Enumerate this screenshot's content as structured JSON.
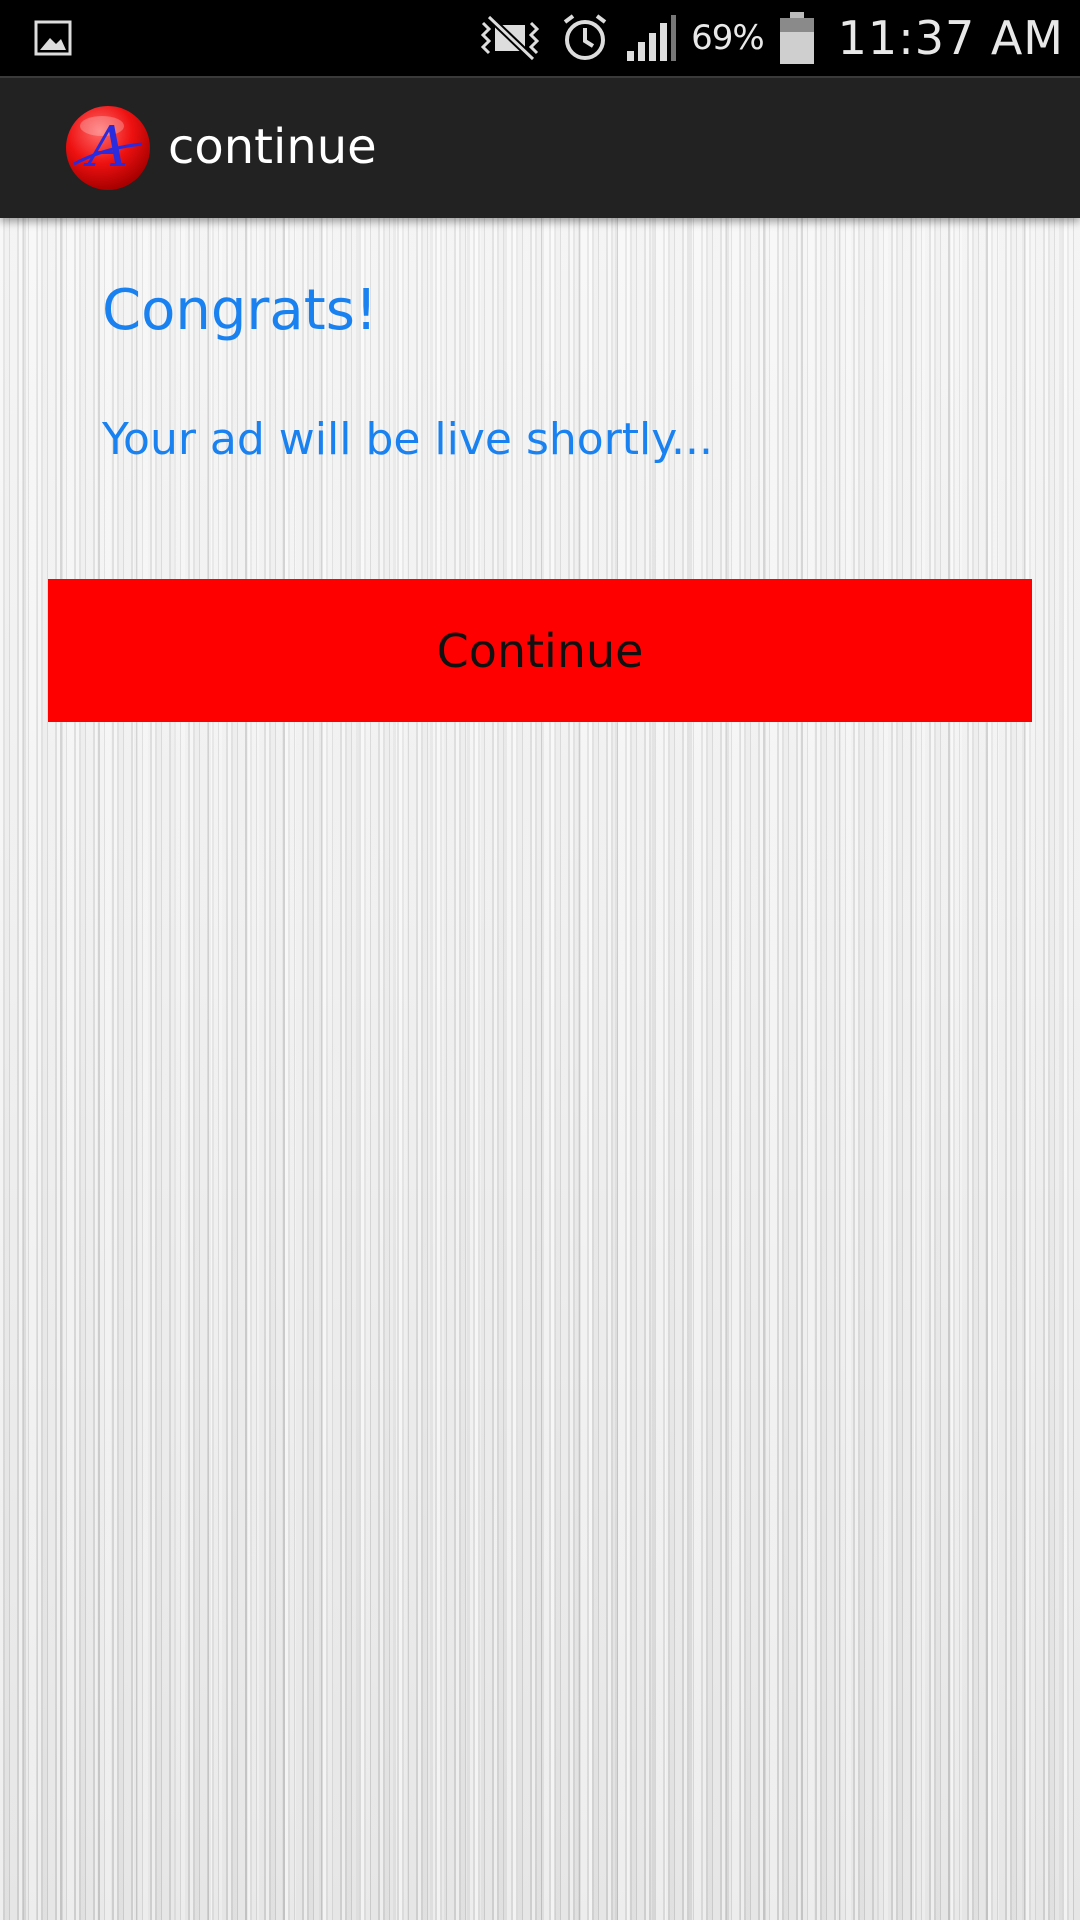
{
  "status_bar": {
    "battery_percent": "69%",
    "time": "11:37 AM",
    "icons": [
      "gallery-icon",
      "mute-icon",
      "alarm-icon",
      "signal-icon",
      "battery-icon"
    ]
  },
  "action_bar": {
    "title": "continue",
    "logo_icon": "app-logo-icon",
    "logo_letter": "A"
  },
  "main": {
    "heading": "Congrats!",
    "message": "Your ad will be live shortly...",
    "continue_label": "Continue"
  },
  "colors": {
    "accent_text": "#1a82f0",
    "button_bg": "#ff0000",
    "action_bar_bg": "#222222",
    "status_bar_bg": "#000000"
  }
}
